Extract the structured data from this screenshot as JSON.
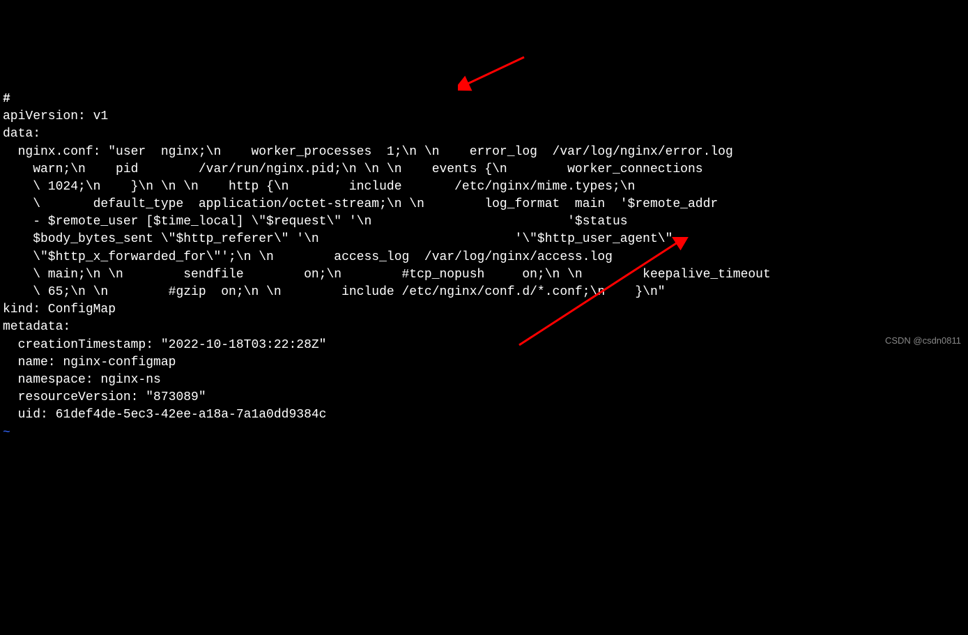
{
  "terminal": {
    "line0": "#",
    "line1": "apiVersion: v1",
    "line2": "data:",
    "line3": "  nginx.conf: \"user  nginx;\\n    worker_processes  1;\\n \\n    error_log  /var/log/nginx/error.log",
    "line4": "    warn;\\n    pid        /var/run/nginx.pid;\\n \\n \\n    events {\\n        worker_connections",
    "line5": "    \\ 1024;\\n    }\\n \\n \\n    http {\\n        include       /etc/nginx/mime.types;\\n",
    "line6": "    \\       default_type  application/octet-stream;\\n \\n        log_format  main  '$remote_addr",
    "line7": "    - $remote_user [$time_local] \\\"$request\\\" '\\n                          '$status",
    "line8": "    $body_bytes_sent \\\"$http_referer\\\" '\\n                          '\\\"$http_user_agent\\\"",
    "line9": "    \\\"$http_x_forwarded_for\\\"';\\n \\n        access_log  /var/log/nginx/access.log",
    "line10": "    \\ main;\\n \\n        sendfile        on;\\n        #tcp_nopush     on;\\n \\n        keepalive_timeout",
    "line11": "    \\ 65;\\n \\n        #gzip  on;\\n \\n        include /etc/nginx/conf.d/*.conf;\\n    }\\n\"",
    "line12": "kind: ConfigMap",
    "line13": "metadata:",
    "line14": "  creationTimestamp: \"2022-10-18T03:22:28Z\"",
    "line15": "  name: nginx-configmap",
    "line16": "  namespace: nginx-ns",
    "line17": "  resourceVersion: \"873089\"",
    "line18": "  uid: 61def4de-5ec3-42ee-a18a-7a1a0dd9384c",
    "tilde": "~"
  },
  "watermark": "CSDN @csdn0811",
  "annotations": {
    "arrow_color": "#ff0000"
  }
}
